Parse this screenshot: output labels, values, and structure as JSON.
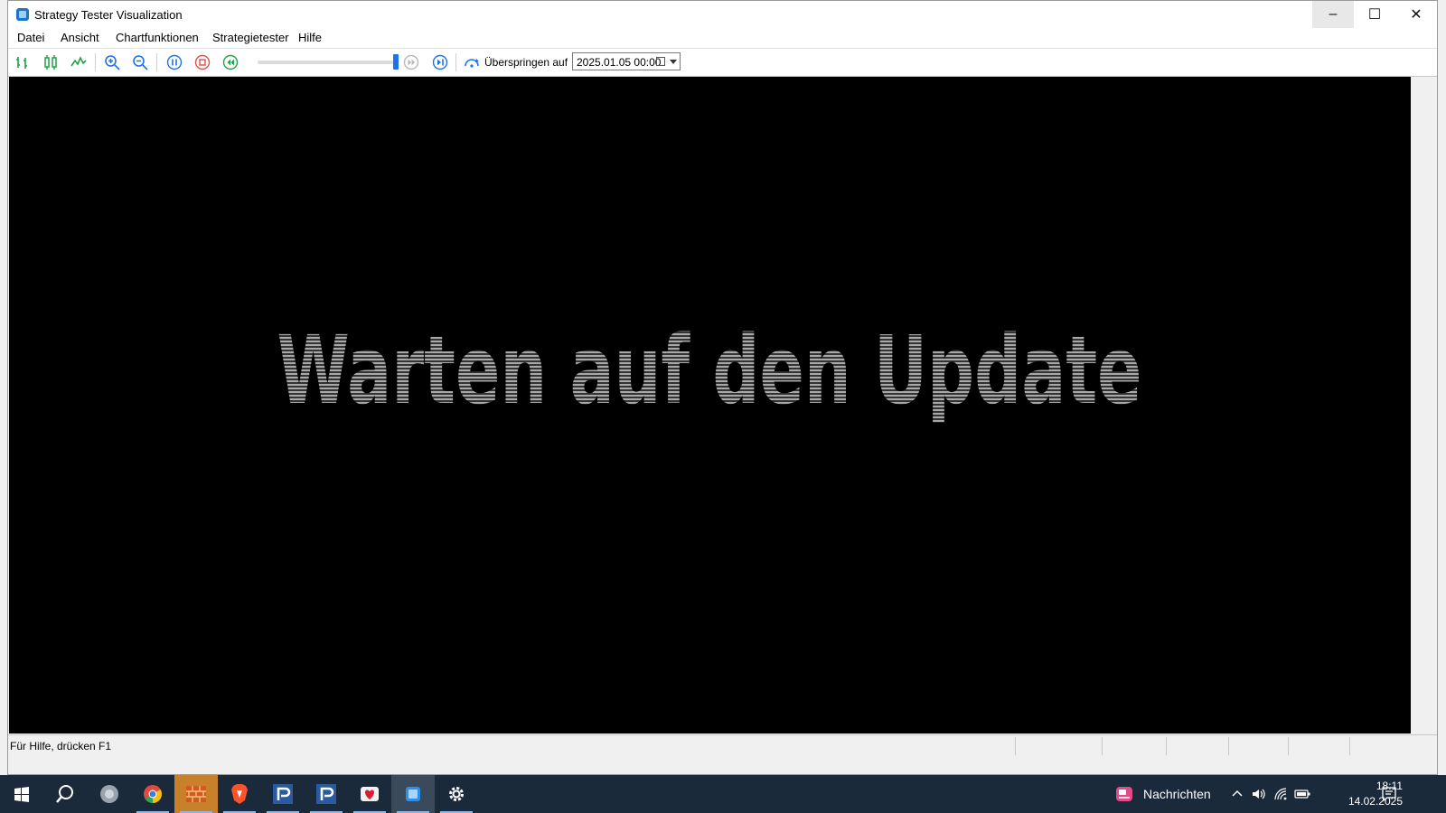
{
  "window": {
    "title": "Strategy Tester Visualization",
    "controls": {
      "minimize": "–",
      "maximize": "☐",
      "close": "✕"
    }
  },
  "menu": [
    "Datei",
    "Ansicht",
    "Chartfunktionen",
    "Strategietester",
    "Hilfe"
  ],
  "toolbar": {
    "icons": [
      "bar-chart-icon",
      "candlestick-icon",
      "line-chart-icon",
      "zoom-in-icon",
      "zoom-out-icon",
      "pause-icon",
      "stop-icon",
      "rewind-icon",
      "step-forward-icon",
      "skip-to-end-icon",
      "skip-to-icon"
    ],
    "speed_level": 1.0,
    "skip_label": "Überspringen auf",
    "skip_date": "2025.01.05 00:00"
  },
  "canvas": {
    "message": "Warten auf den Update",
    "background": "#000000"
  },
  "status": {
    "help_text": "Für Hilfe, drücken F1"
  },
  "taskbar": {
    "apps": [
      "start-icon",
      "search-icon",
      "app-icon",
      "chrome-icon",
      "brick-app-icon",
      "brave-icon",
      "platform-p-icon",
      "platform-p-icon",
      "heart-app-icon",
      "strategy-tester-icon",
      "settings-icon"
    ],
    "news_label": "Nachrichten",
    "time": "18:11",
    "date": "14.02.2025"
  }
}
